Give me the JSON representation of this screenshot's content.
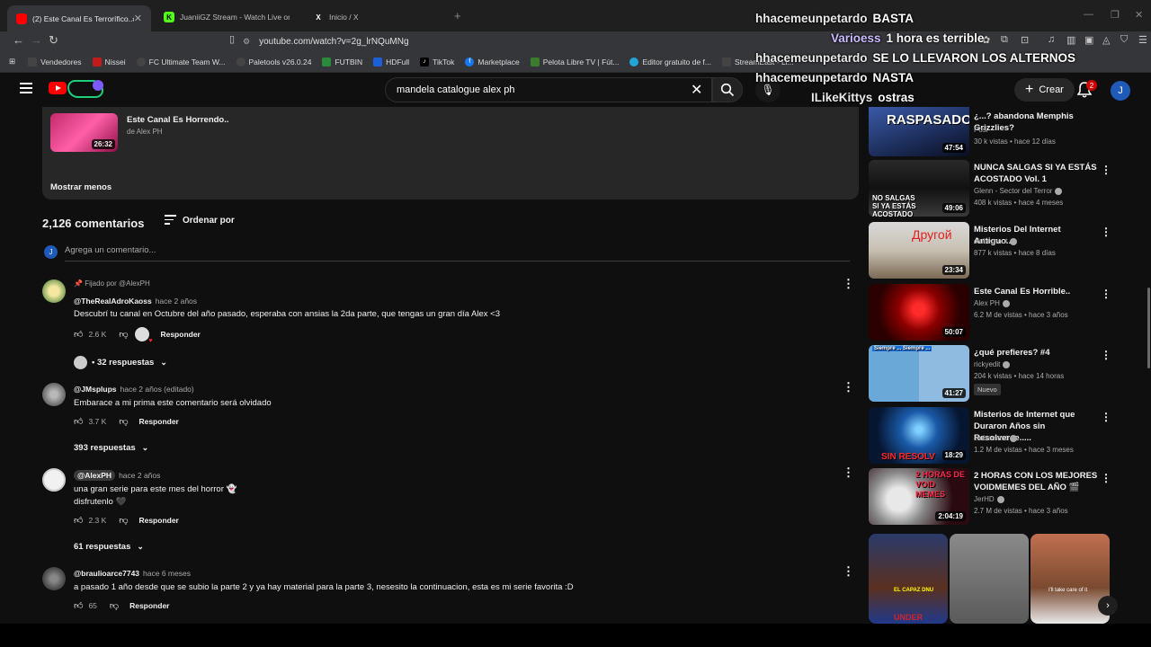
{
  "browser": {
    "tabs": [
      {
        "title": "(2) Este Canal Es Terrorífico..#2",
        "favicon_color": "#ff0000",
        "active": true
      },
      {
        "title": "JuaniiGZ Stream - Watch Live on",
        "favicon_color": "#53fc18",
        "active": false
      },
      {
        "title": "Inicio / X",
        "favicon_color": "#000000",
        "active": false
      }
    ],
    "url": "youtube.com/watch?v=2g_lrNQuMNg",
    "bookmarks": [
      "Vendedores",
      "Nissei",
      "FC Ultimate Team W...",
      "Paletools v26.0.24",
      "FUTBIN",
      "HDFull",
      "TikTok",
      "Marketplace",
      "Pelota Libre TV | Fút...",
      "Editor gratuito de f...",
      "StreamEast - Li..."
    ]
  },
  "youtube": {
    "search_query": "mandela catalogue alex ph",
    "create_label": "Crear",
    "notification_count": "2",
    "avatar_letter": "J"
  },
  "overlay_chat": [
    {
      "user": "hhacemeunpetardo",
      "message": "BASTA"
    },
    {
      "user": "Varioess",
      "message": "1 hora es terrible"
    },
    {
      "user": "hhacemeunpetardo",
      "message": "SE LO LLEVARON LOS ALTERNOS"
    },
    {
      "user": "hhacemeunpetardo",
      "message": "NASTA"
    },
    {
      "user": "ILikeKittys",
      "message": "ostras"
    }
  ],
  "description": {
    "video_title": "Este Canal Es Horrendo..",
    "by": "de Alex PH",
    "duration": "26:32",
    "show_less": "Mostrar menos"
  },
  "comments_section": {
    "count": "2,126 comentarios",
    "sort_label": "Ordenar por",
    "add_placeholder": "Agrega un comentario...",
    "avatar_letter": "J"
  },
  "comments": [
    {
      "pinned": "Fijado por @AlexPH",
      "handle": "@TheRealAdroKaoss",
      "time": "hace 2 años",
      "text": [
        "Descubrí tu canal en Octubre del año pasado, esperaba con ansias la 2da parte, que tengas un gran día Alex <3"
      ],
      "likes": "2.6 K",
      "reply": "Responder",
      "replies": "• 32 respuestas"
    },
    {
      "handle": "@JMsplups",
      "time": "hace 2 años (editado)",
      "text": [
        "Embarace a mi prima este comentario será olvidado"
      ],
      "likes": "3.7 K",
      "reply": "Responder",
      "replies": "393 respuestas"
    },
    {
      "handle": "@AlexPH",
      "time": "hace 2 años",
      "text": [
        "una gran serie para este mes del horror 👻",
        "disfrutenlo 🖤"
      ],
      "likes": "2.3 K",
      "reply": "Responder",
      "replies": "61 respuestas"
    },
    {
      "handle": "@braulioarce7743",
      "time": "hace 6 meses",
      "text": [
        "a pasado 1 año desde que se subio la parte 2 y ya hay material para la parte 3, nesesito la continuacion, esta es mi serie favorita :D"
      ],
      "likes": "65",
      "reply": "Responder"
    }
  ],
  "related": [
    {
      "title": "¿...? abandona Memphis Grizzlies?",
      "channel": "Posi",
      "stats": "30 k vistas • hace 12 días",
      "duration": "47:54",
      "caption": "RASPASADO"
    },
    {
      "title": "NUNCA SALGAS SI YA ESTÁS ACOSTADO Vol. 1",
      "channel": "Glenn - Sector del Terror",
      "stats": "408 k vistas • hace 4 meses",
      "duration": "49:06",
      "caption": "NO SALGAS SI YA ESTÁS ACOSTADO"
    },
    {
      "title": "Misterios Del Internet Antiguo...",
      "channel": "clubernaut",
      "stats": "877 k vistas • hace 8 días",
      "duration": "23:34",
      "caption": "Другой"
    },
    {
      "title": "Este Canal Es Horrible..",
      "channel": "Alex PH",
      "stats": "6.2 M de vistas • hace 3 años",
      "duration": "50:07",
      "caption": ""
    },
    {
      "title": "¿qué prefieres? #4",
      "channel": "rickyedit",
      "stats": "204 k vistas • hace 14 horas",
      "duration": "41:27",
      "caption": "Siempre ... Siempre ...",
      "badge": "Nuevo"
    },
    {
      "title": "Misterios de Internet que Duraron Años sin Resolverse.....",
      "channel": "clubernaut",
      "stats": "1.2 M de vistas • hace 3 meses",
      "duration": "18:29",
      "caption": "SIN RESOLV"
    },
    {
      "title": "2 HORAS CON LOS MEJORES VOIDMEMES DEL AÑO 🎬",
      "channel": "JerHD",
      "stats": "2.7 M de vistas • hace 3 años",
      "duration": "2:04:19",
      "caption": "2 HORAS DE VOID MEMES"
    }
  ],
  "shorts": [
    {
      "caption": "EL CAPAZ DNU",
      "bottom": "UNDER"
    },
    {
      "caption": "",
      "bottom": ""
    },
    {
      "caption": "I'll take care of it",
      "bottom": ""
    }
  ]
}
